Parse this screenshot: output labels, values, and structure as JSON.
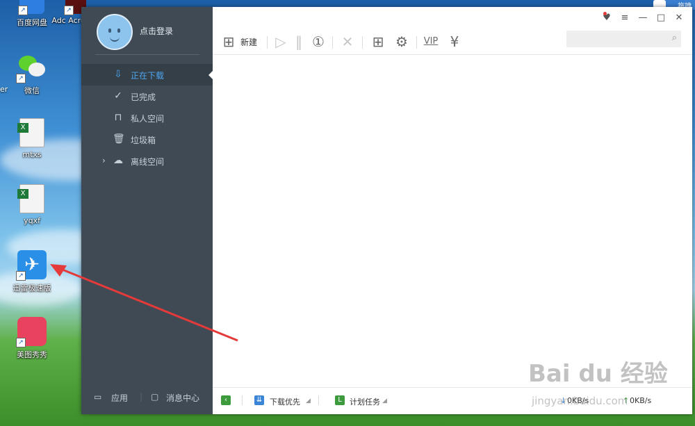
{
  "desktop": {
    "icons": [
      {
        "label": "百度网盘",
        "name": "baidu-netdisk"
      },
      {
        "label": "Adc Acrob",
        "name": "adobe-acrobat"
      },
      {
        "label": "微信",
        "name": "wechat"
      },
      {
        "label": "mtxs",
        "name": "excel-file-mtxs"
      },
      {
        "label": "yqxf",
        "name": "excel-file-yqxf"
      },
      {
        "label": "迅雷极速版",
        "name": "xunlei-speed"
      },
      {
        "label": "美图秀秀",
        "name": "meitu"
      }
    ],
    "partial_left_label": "er",
    "topright_label": "拖拽"
  },
  "sidebar": {
    "login": "点击登录",
    "items": [
      {
        "label": "正在下载",
        "icon": "download-icon",
        "active": true
      },
      {
        "label": "已完成",
        "icon": "check-circle-icon",
        "active": false
      },
      {
        "label": "私人空间",
        "icon": "lock-icon",
        "active": false
      },
      {
        "label": "垃圾箱",
        "icon": "trash-icon",
        "active": false
      },
      {
        "label": "离线空间",
        "icon": "cloud-download-icon",
        "active": false
      }
    ],
    "bottom": {
      "apps": "应用",
      "messages": "消息中心"
    }
  },
  "toolbar": {
    "new_label": "新建",
    "vip": "VIP"
  },
  "status": {
    "priority": "下载优先",
    "schedule": "计划任务",
    "down_speed": "0KB/s",
    "up_speed": "0KB/s"
  },
  "watermark": {
    "main": "Bai du 经验",
    "sub": "jingyan.baidu.com"
  },
  "colors": {
    "accent": "#4ea5ef",
    "sidebar": "#3f4a54",
    "annotation_arrow": "#e53a3a"
  }
}
